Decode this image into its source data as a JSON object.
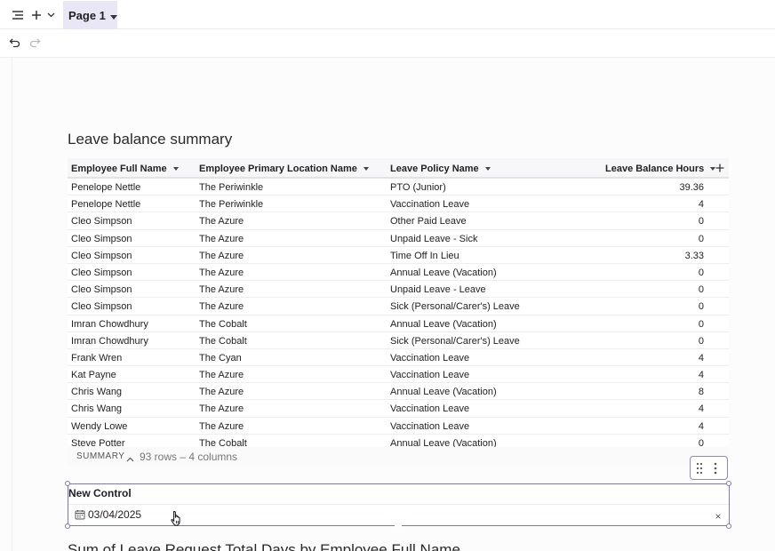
{
  "topbar": {
    "menu_icon": "menu-icon",
    "add_icon": "plus-icon",
    "chevron_icon": "chevron-down-icon",
    "page_tab_label": "Page 1"
  },
  "toolbar": {
    "undo_icon": "undo-icon",
    "redo_icon": "redo-icon"
  },
  "table_section": {
    "title": "Leave balance summary",
    "columns": [
      "Employee Full Name",
      "Employee Primary Location Name",
      "Leave Policy Name",
      "Leave Balance Hours"
    ],
    "rows": [
      [
        "Penelope Nettle",
        "The Periwinkle",
        "PTO (Junior)",
        "39.36"
      ],
      [
        "Penelope Nettle",
        "The Periwinkle",
        "Vaccination Leave",
        "4"
      ],
      [
        "Cleo Simpson",
        "The Azure",
        "Other Paid Leave",
        "0"
      ],
      [
        "Cleo Simpson",
        "The Azure",
        "Unpaid Leave - Sick",
        "0"
      ],
      [
        "Cleo Simpson",
        "The Azure",
        "Time Off In Lieu",
        "3.33"
      ],
      [
        "Cleo Simpson",
        "The Azure",
        "Annual Leave (Vacation)",
        "0"
      ],
      [
        "Cleo Simpson",
        "The Azure",
        "Unpaid Leave - Leave",
        "0"
      ],
      [
        "Cleo Simpson",
        "The Azure",
        "Sick (Personal/Carer's) Leave",
        "0"
      ],
      [
        "Imran Chowdhury",
        "The Cobalt",
        "Annual Leave (Vacation)",
        "0"
      ],
      [
        "Imran Chowdhury",
        "The Cobalt",
        "Sick (Personal/Carer's) Leave",
        "0"
      ],
      [
        "Frank Wren",
        "The Cyan",
        "Vaccination Leave",
        "4"
      ],
      [
        "Kat Payne",
        "The Azure",
        "Vaccination Leave",
        "4"
      ],
      [
        "Chris Wang",
        "The Azure",
        "Annual Leave (Vacation)",
        "8"
      ],
      [
        "Chris Wang",
        "The Azure",
        "Vaccination Leave",
        "4"
      ],
      [
        "Wendy Lowe",
        "The Azure",
        "Vaccination Leave",
        "4"
      ],
      [
        "Steve Potter",
        "The Cobalt",
        "Annual Leave (Vacation)",
        "0"
      ]
    ],
    "summary_label": "SUMMARY",
    "summary_count": "93 rows – 4 columns"
  },
  "control": {
    "title": "New Control",
    "date_value": "03/04/2025",
    "clear_label": "×"
  },
  "next_section": {
    "title": "Sum of Leave Request Total Days by Employee Full Name"
  },
  "colors": {
    "accent": "#7a78b0",
    "tab_bg": "#e9e6f5"
  }
}
